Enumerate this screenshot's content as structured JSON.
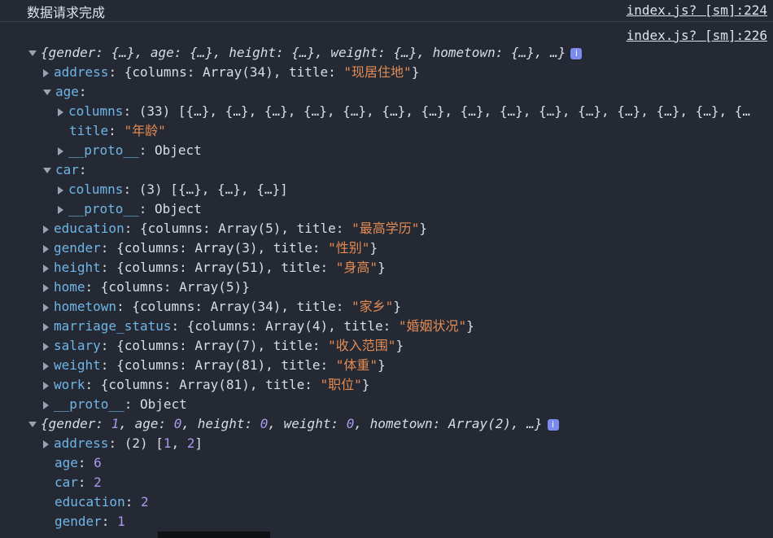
{
  "top": {
    "message": "数据请求完成",
    "source1": "index.js? [sm]:224",
    "source2": "index.js? [sm]:226"
  },
  "obj1": {
    "summary": "{gender: {…}, age: {…}, height: {…}, weight: {…}, hometown: {…}, …}",
    "info": "i",
    "address": {
      "key": "address",
      "val": "{columns: Array(34), title: ",
      "title": "\"现居住地\"",
      "end": "}"
    },
    "age": {
      "key": "age",
      "colon": ":",
      "columns_key": "columns",
      "columns_val": ": (33) [{…}, {…}, {…}, {…}, {…}, {…}, {…}, {…}, {…}, {…}, {…}, {…}, {…}, {…}, {…",
      "title_key": "title",
      "title_val": "\"年龄\"",
      "proto_key": "__proto__",
      "proto_val": ": Object"
    },
    "car": {
      "key": "car",
      "colon": ":",
      "columns_key": "columns",
      "columns_val": ": (3) [{…}, {…}, {…}]",
      "proto_key": "__proto__",
      "proto_val": ": Object"
    },
    "education": {
      "key": "education",
      "val": ": {columns: Array(5), title: ",
      "title": "\"最高学历\"",
      "end": "}"
    },
    "gender": {
      "key": "gender",
      "val": ": {columns: Array(3), title: ",
      "title": "\"性别\"",
      "end": "}"
    },
    "height": {
      "key": "height",
      "val": ": {columns: Array(51), title: ",
      "title": "\"身高\"",
      "end": "}"
    },
    "home": {
      "key": "home",
      "val": ": {columns: Array(5)}"
    },
    "hometown": {
      "key": "hometown",
      "val": ": {columns: Array(34), title: ",
      "title": "\"家乡\"",
      "end": "}"
    },
    "marriage_status": {
      "key": "marriage_status",
      "val": ": {columns: Array(4), title: ",
      "title": "\"婚姻状况\"",
      "end": "}"
    },
    "salary": {
      "key": "salary",
      "val": ": {columns: Array(7), title: ",
      "title": "\"收入范围\"",
      "end": "}"
    },
    "weight": {
      "key": "weight",
      "val": ": {columns: Array(81), title: ",
      "title": "\"体重\"",
      "end": "}"
    },
    "work": {
      "key": "work",
      "val": ": {columns: Array(81), title: ",
      "title": "\"职位\"",
      "end": "}"
    },
    "proto": {
      "key": "__proto__",
      "val": ": Object"
    }
  },
  "obj2": {
    "s1": "{gender: ",
    "n1": "1",
    "s2": ", age: ",
    "n2": "0",
    "s3": ", height: ",
    "n3": "0",
    "s4": ", weight: ",
    "n4": "0",
    "s5": ", hometown: Array(2), …}",
    "info": "i",
    "address": {
      "key": "address",
      "pre": ": (2) [",
      "a": "1",
      "sep": ", ",
      "b": "2",
      "end": "]"
    },
    "age": {
      "key": "age",
      "val": "6"
    },
    "car": {
      "key": "car",
      "val": "2"
    },
    "education": {
      "key": "education",
      "val": "2"
    },
    "gender": {
      "key": "gender",
      "val": "1"
    }
  }
}
